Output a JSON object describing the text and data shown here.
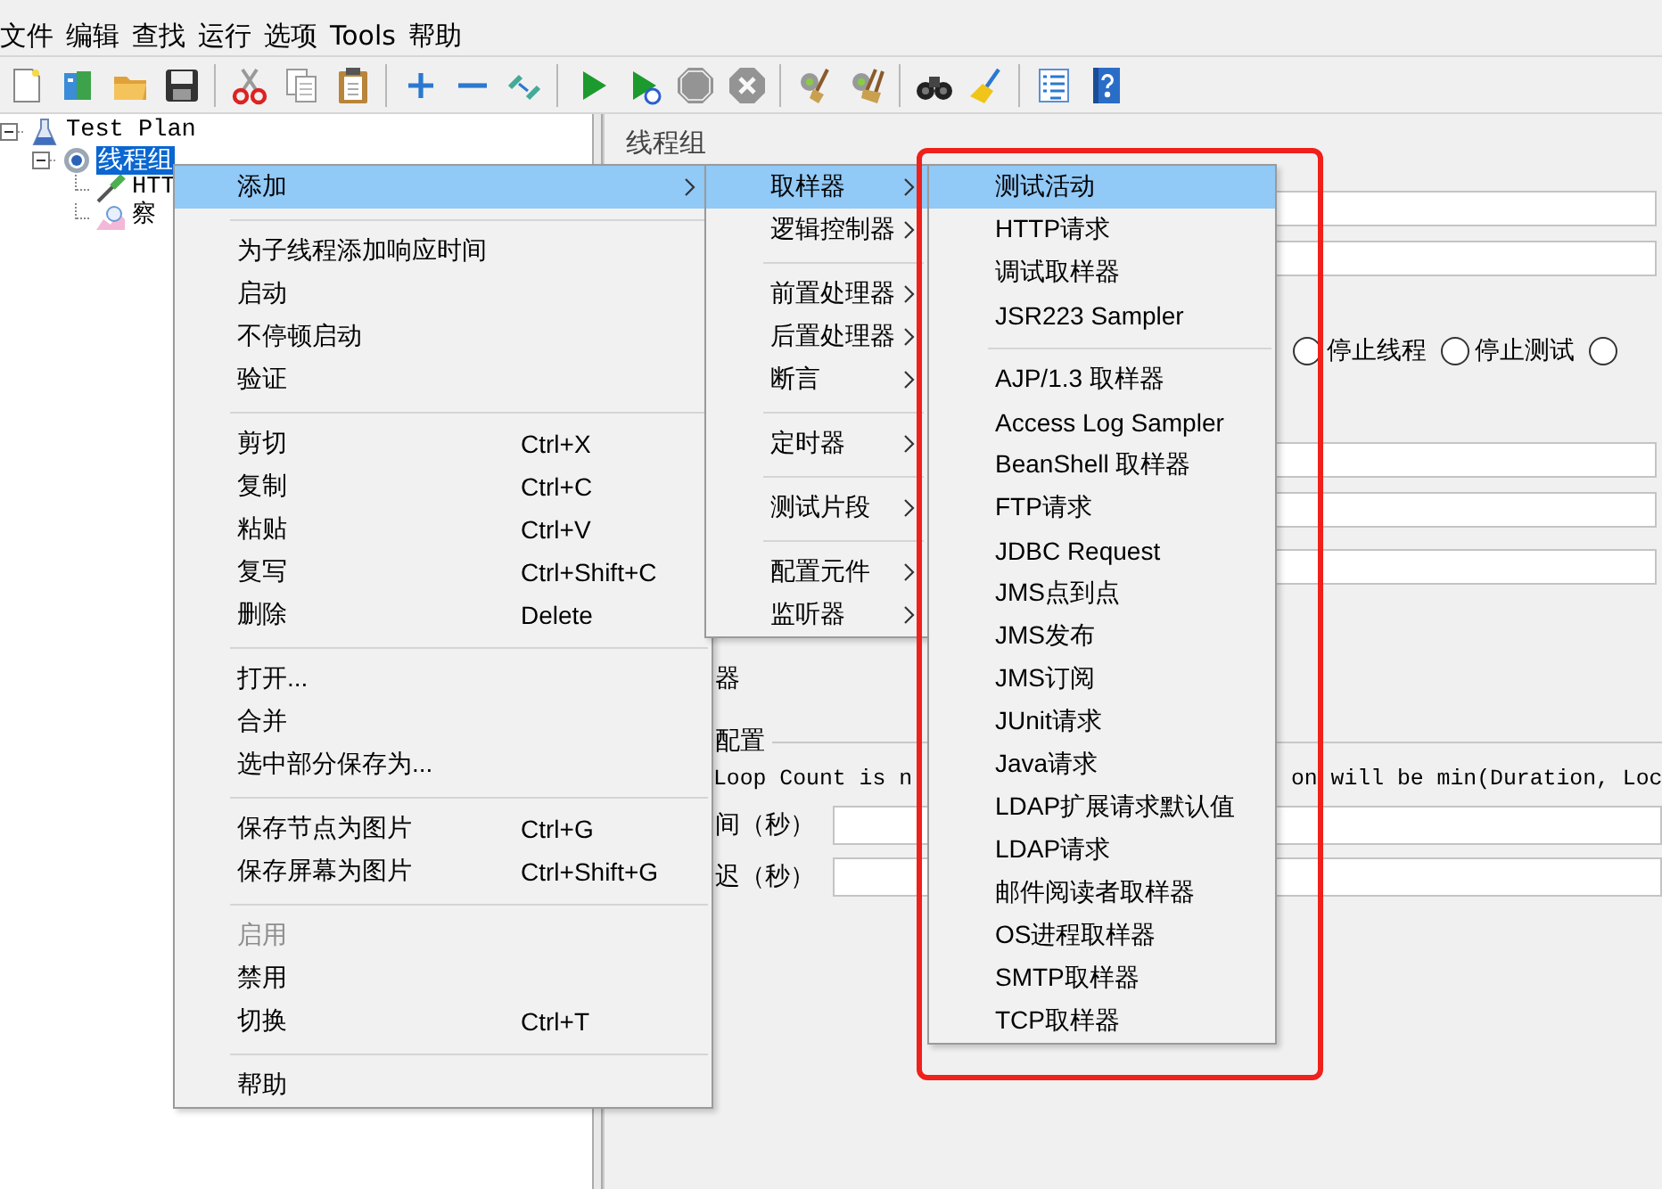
{
  "menubar": [
    "文件",
    "编辑",
    "查找",
    "运行",
    "选项",
    "Tools",
    "帮助"
  ],
  "toolbar": [
    {
      "kind": "new",
      "disabled": false
    },
    {
      "kind": "templates",
      "disabled": false
    },
    {
      "kind": "open",
      "disabled": false
    },
    {
      "kind": "save",
      "disabled": false
    },
    {
      "kind": "separator"
    },
    {
      "kind": "cut",
      "disabled": false
    },
    {
      "kind": "copy",
      "disabled": false
    },
    {
      "kind": "paste",
      "disabled": false
    },
    {
      "kind": "separator"
    },
    {
      "kind": "expand",
      "disabled": false
    },
    {
      "kind": "collapse",
      "disabled": false
    },
    {
      "kind": "toggle",
      "disabled": false
    },
    {
      "kind": "separator"
    },
    {
      "kind": "start",
      "disabled": false
    },
    {
      "kind": "start_no_timers",
      "disabled": false
    },
    {
      "kind": "stop",
      "disabled": true
    },
    {
      "kind": "shutdown",
      "disabled": true
    },
    {
      "kind": "separator"
    },
    {
      "kind": "clear",
      "disabled": false
    },
    {
      "kind": "clear_all",
      "disabled": false
    },
    {
      "kind": "separator"
    },
    {
      "kind": "search",
      "disabled": false
    },
    {
      "kind": "reset_search",
      "disabled": false
    },
    {
      "kind": "separator"
    },
    {
      "kind": "function_helper",
      "disabled": false
    },
    {
      "kind": "help",
      "disabled": false
    }
  ],
  "tree": [
    {
      "label": "Test Plan",
      "kind": "test_plan",
      "selected": false,
      "expanded": true,
      "children": [
        {
          "label": "线程组",
          "kind": "thread_group",
          "selected": true,
          "expanded": true,
          "children": [
            {
              "label": "HTT",
              "kind": "sampler",
              "selected": false
            },
            {
              "label": "察",
              "kind": "listener",
              "selected": false
            }
          ]
        }
      ]
    }
  ],
  "panel": {
    "title": "线程组",
    "radios": [
      {
        "label": "停止线程",
        "checked": false
      },
      {
        "label": "停止测试",
        "checked": false
      },
      {
        "checked": false
      }
    ],
    "section_label": "器",
    "group_label": "配置",
    "note_start": "Loop Count is n",
    "note_end": "on will be min(Duration, Loc",
    "fields": [
      {
        "label": "间（秒）"
      },
      {
        "label": "迟（秒）"
      }
    ]
  },
  "context_menu": {
    "items": [
      {
        "kind": "item",
        "label": "添加",
        "selected": true,
        "disabled": false,
        "has_submenu": true
      },
      {
        "kind": "separator"
      },
      {
        "kind": "item",
        "label": "为子线程添加响应时间",
        "selected": false,
        "disabled": false,
        "has_submenu": false
      },
      {
        "kind": "item",
        "label": "启动",
        "selected": false,
        "disabled": false,
        "has_submenu": false
      },
      {
        "kind": "item",
        "label": "不停顿启动",
        "selected": false,
        "disabled": false,
        "has_submenu": false
      },
      {
        "kind": "item",
        "label": "验证",
        "selected": false,
        "disabled": false,
        "has_submenu": false
      },
      {
        "kind": "separator"
      },
      {
        "kind": "item",
        "label": "剪切",
        "shortcut": "Ctrl+X",
        "selected": false,
        "disabled": false,
        "has_submenu": false
      },
      {
        "kind": "item",
        "label": "复制",
        "shortcut": "Ctrl+C",
        "selected": false,
        "disabled": false,
        "has_submenu": false
      },
      {
        "kind": "item",
        "label": "粘贴",
        "shortcut": "Ctrl+V",
        "selected": false,
        "disabled": false,
        "has_submenu": false
      },
      {
        "kind": "item",
        "label": "复写",
        "shortcut": "Ctrl+Shift+C",
        "selected": false,
        "disabled": false,
        "has_submenu": false
      },
      {
        "kind": "item",
        "label": "删除",
        "shortcut": "Delete",
        "selected": false,
        "disabled": false,
        "has_submenu": false
      },
      {
        "kind": "separator"
      },
      {
        "kind": "item",
        "label": "打开...",
        "selected": false,
        "disabled": false,
        "has_submenu": false
      },
      {
        "kind": "item",
        "label": "合并",
        "selected": false,
        "disabled": false,
        "has_submenu": false
      },
      {
        "kind": "item",
        "label": "选中部分保存为...",
        "selected": false,
        "disabled": false,
        "has_submenu": false
      },
      {
        "kind": "separator"
      },
      {
        "kind": "item",
        "label": "保存节点为图片",
        "shortcut": "Ctrl+G",
        "selected": false,
        "disabled": false,
        "has_submenu": false
      },
      {
        "kind": "item",
        "label": "保存屏幕为图片",
        "shortcut": "Ctrl+Shift+G",
        "selected": false,
        "disabled": false,
        "has_submenu": false
      },
      {
        "kind": "separator"
      },
      {
        "kind": "item",
        "label": "启用",
        "selected": false,
        "disabled": true,
        "has_submenu": false
      },
      {
        "kind": "item",
        "label": "禁用",
        "selected": false,
        "disabled": false,
        "has_submenu": false
      },
      {
        "kind": "item",
        "label": "切换",
        "shortcut": "Ctrl+T",
        "selected": false,
        "disabled": false,
        "has_submenu": false
      },
      {
        "kind": "separator"
      },
      {
        "kind": "item",
        "label": "帮助",
        "selected": false,
        "disabled": false,
        "has_submenu": false
      }
    ]
  },
  "add_submenu": {
    "items": [
      {
        "kind": "item",
        "label": "取样器",
        "selected": true,
        "has_submenu": true
      },
      {
        "kind": "item",
        "label": "逻辑控制器",
        "selected": false,
        "has_submenu": true
      },
      {
        "kind": "separator"
      },
      {
        "kind": "item",
        "label": "前置处理器",
        "selected": false,
        "has_submenu": true
      },
      {
        "kind": "item",
        "label": "后置处理器",
        "selected": false,
        "has_submenu": true
      },
      {
        "kind": "item",
        "label": "断言",
        "selected": false,
        "has_submenu": true
      },
      {
        "kind": "separator"
      },
      {
        "kind": "item",
        "label": "定时器",
        "selected": false,
        "has_submenu": true
      },
      {
        "kind": "separator"
      },
      {
        "kind": "item",
        "label": "测试片段",
        "selected": false,
        "has_submenu": true
      },
      {
        "kind": "separator"
      },
      {
        "kind": "item",
        "label": "配置元件",
        "selected": false,
        "has_submenu": true
      },
      {
        "kind": "item",
        "label": "监听器",
        "selected": false,
        "has_submenu": true
      }
    ]
  },
  "sampler_submenu": {
    "items": [
      {
        "kind": "item",
        "label": "测试活动",
        "selected": true
      },
      {
        "kind": "item",
        "label": "HTTP请求",
        "selected": false
      },
      {
        "kind": "item",
        "label": "调试取样器",
        "selected": false
      },
      {
        "kind": "item",
        "label": "JSR223 Sampler",
        "selected": false
      },
      {
        "kind": "separator"
      },
      {
        "kind": "item",
        "label": "AJP/1.3 取样器",
        "selected": false
      },
      {
        "kind": "item",
        "label": "Access Log Sampler",
        "selected": false
      },
      {
        "kind": "item",
        "label": "BeanShell 取样器",
        "selected": false
      },
      {
        "kind": "item",
        "label": "FTP请求",
        "selected": false
      },
      {
        "kind": "item",
        "label": "JDBC Request",
        "selected": false
      },
      {
        "kind": "item",
        "label": "JMS点到点",
        "selected": false
      },
      {
        "kind": "item",
        "label": "JMS发布",
        "selected": false
      },
      {
        "kind": "item",
        "label": "JMS订阅",
        "selected": false
      },
      {
        "kind": "item",
        "label": "JUnit请求",
        "selected": false
      },
      {
        "kind": "item",
        "label": "Java请求",
        "selected": false
      },
      {
        "kind": "item",
        "label": "LDAP扩展请求默认值",
        "selected": false
      },
      {
        "kind": "item",
        "label": "LDAP请求",
        "selected": false
      },
      {
        "kind": "item",
        "label": "邮件阅读者取样器",
        "selected": false
      },
      {
        "kind": "item",
        "label": "OS进程取样器",
        "selected": false
      },
      {
        "kind": "item",
        "label": "SMTP取样器",
        "selected": false
      },
      {
        "kind": "item",
        "label": "TCP取样器",
        "selected": false
      }
    ]
  },
  "annotation": {
    "kind": "frame"
  }
}
